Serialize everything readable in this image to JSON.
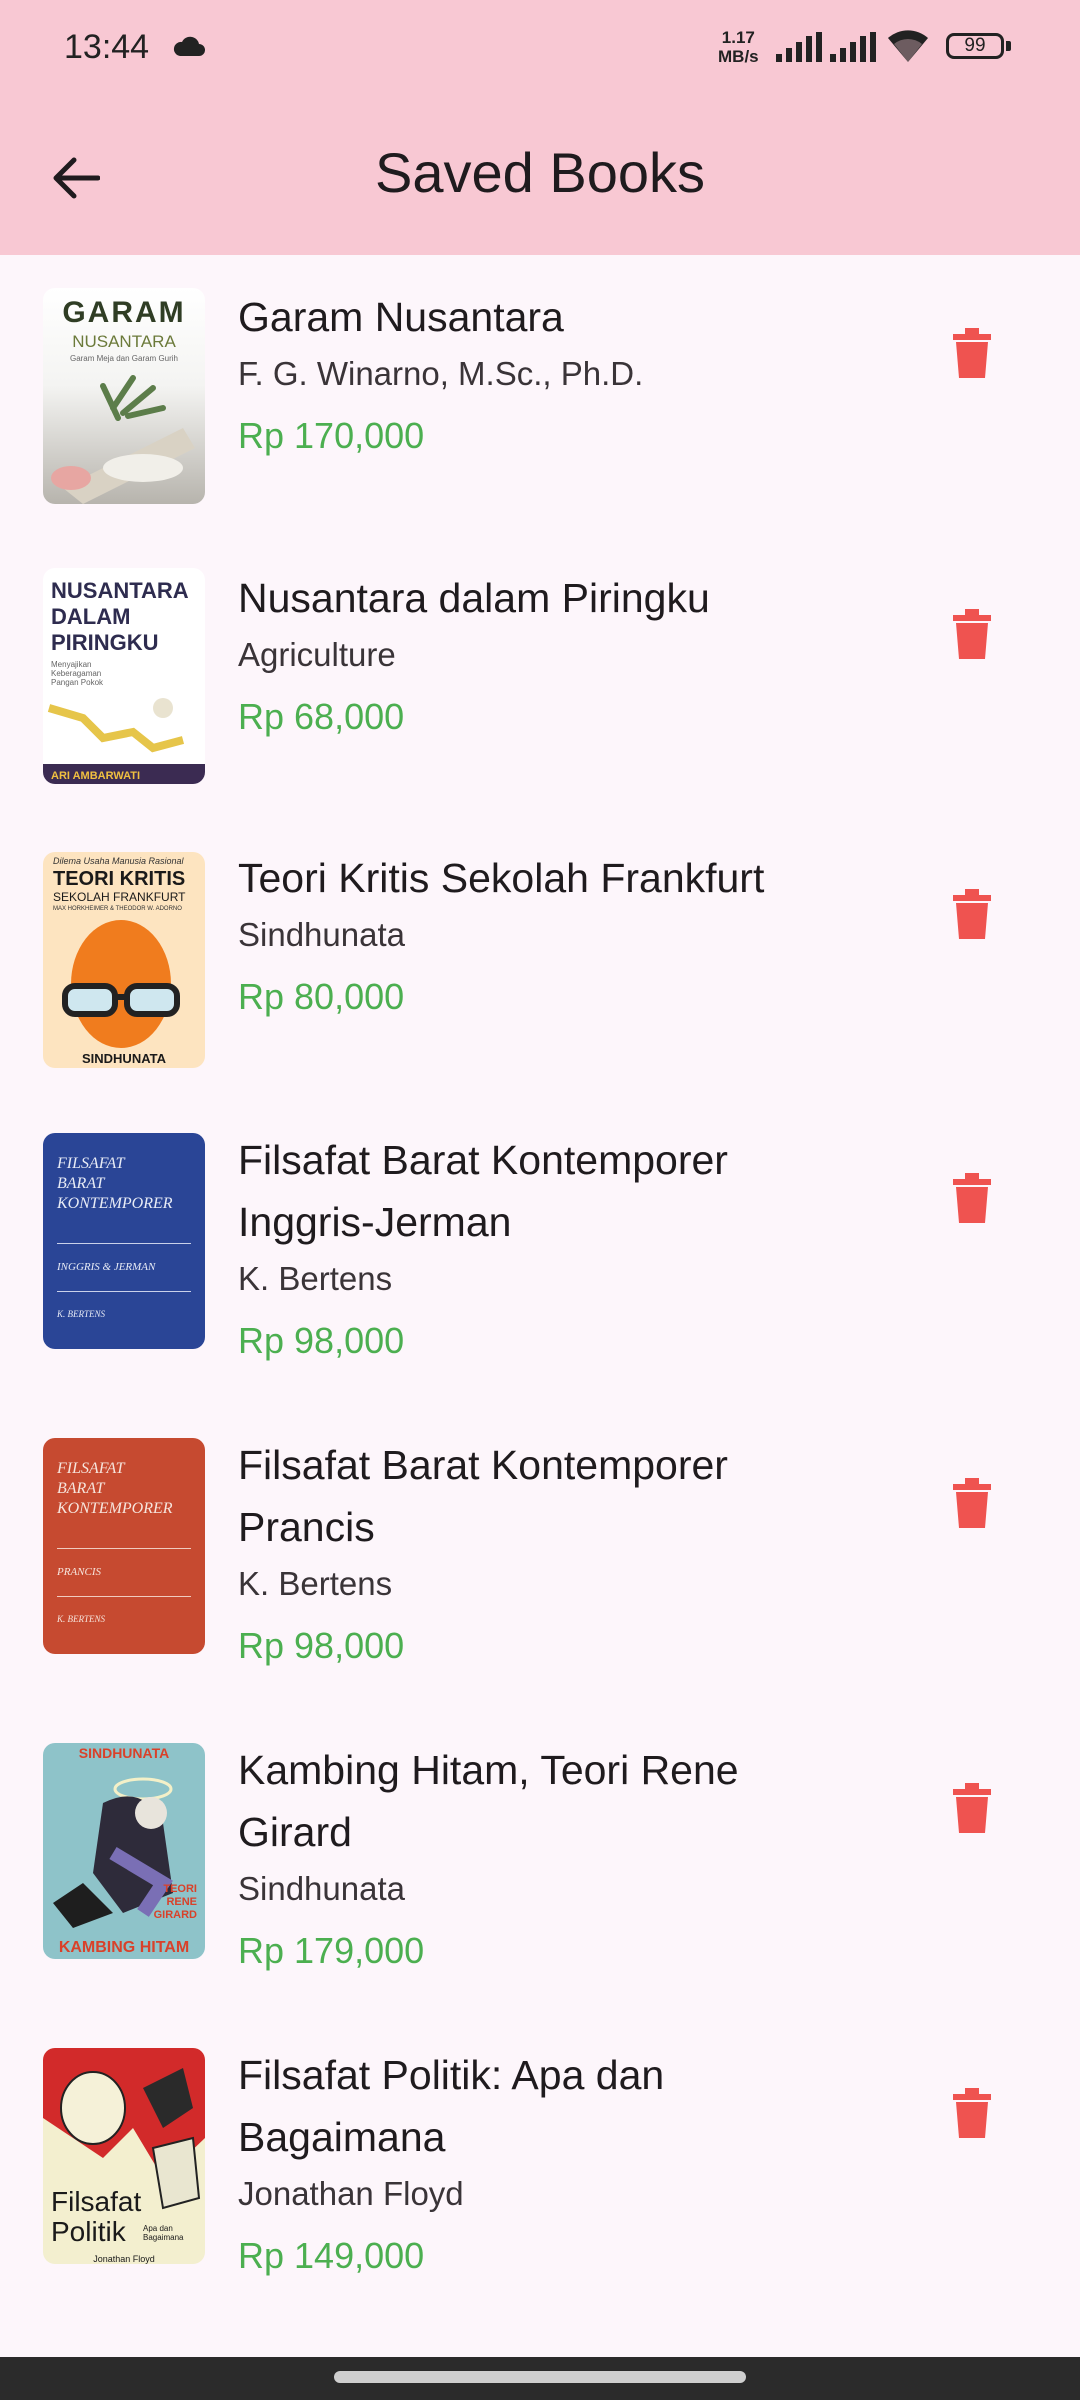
{
  "status_bar": {
    "time": "13:44",
    "net_speed_value": "1.17",
    "net_speed_unit": "MB/s",
    "battery": "99"
  },
  "header": {
    "title": "Saved Books"
  },
  "books": [
    {
      "title": "Garam Nusantara",
      "author": "F. G. Winarno, M.Sc., Ph.D.",
      "price": "Rp 170,000",
      "cover_icon": "garam-nusantara-cover"
    },
    {
      "title": "Nusantara dalam Piringku",
      "author": "Agriculture",
      "price": "Rp 68,000",
      "cover_icon": "nusantara-dalam-piringku-cover"
    },
    {
      "title": "Teori Kritis Sekolah Frankfurt",
      "author": "Sindhunata",
      "price": "Rp 80,000",
      "cover_icon": "teori-kritis-cover"
    },
    {
      "title": "Filsafat Barat Kontemporer Inggris-Jerman",
      "author": "K. Bertens",
      "price": "Rp 98,000",
      "cover_icon": "filsafat-inggris-jerman-cover"
    },
    {
      "title": "Filsafat Barat Kontemporer Prancis",
      "author": "K. Bertens",
      "price": "Rp 98,000",
      "cover_icon": "filsafat-prancis-cover"
    },
    {
      "title": "Kambing Hitam, Teori Rene Girard",
      "author": "Sindhunata",
      "price": "Rp 179,000",
      "cover_icon": "kambing-hitam-cover"
    },
    {
      "title": "Filsafat Politik: Apa dan Bagaimana",
      "author": "Jonathan Floyd",
      "price": "Rp 149,000",
      "cover_icon": "filsafat-politik-cover"
    }
  ],
  "covers": {
    "c1": {
      "line1": "GARAM",
      "line2": "NUSANTARA",
      "line3": "Garam Meja dan Garam Gurih"
    },
    "c2": {
      "line1": "NUSANTARA",
      "line2": "DALAM",
      "line3": "PIRINGKU",
      "line4": "Menyajikan Keberagaman Pangan Pokok",
      "author": "ARI AMBARWATI"
    },
    "c3": {
      "line0": "Dilema Usaha Manusia Rasional",
      "line1": "TEORI KRITIS",
      "line2": "SEKOLAH FRANKFURT",
      "line3": "MAX HORKHEIMER & THEODOR W. ADORNO",
      "author": "SINDHUNATA"
    },
    "c4": {
      "line1": "FILSAFAT",
      "line2": "BARAT",
      "line3": "KONTEMPORER",
      "line4": "INGGRIS & JERMAN",
      "author": "K. BERTENS"
    },
    "c5": {
      "line1": "FILSAFAT",
      "line2": "BARAT",
      "line3": "KONTEMPORER",
      "line4": "PRANCIS",
      "author": "K. BERTENS"
    },
    "c6": {
      "top": "SINDHUNATA",
      "line1": "TEORI",
      "line2": "RENE",
      "line3": "GIRARD",
      "bottom": "KAMBING HITAM"
    },
    "c7": {
      "line1": "Filsafat",
      "line2": "Politik",
      "line3": "Apa dan Bagaimana",
      "author": "Jonathan Floyd"
    }
  },
  "colors": {
    "header_bg": "#f8c8d3",
    "page_bg": "#fdf6fb",
    "price": "#4caf50",
    "delete": "#ef5350"
  }
}
